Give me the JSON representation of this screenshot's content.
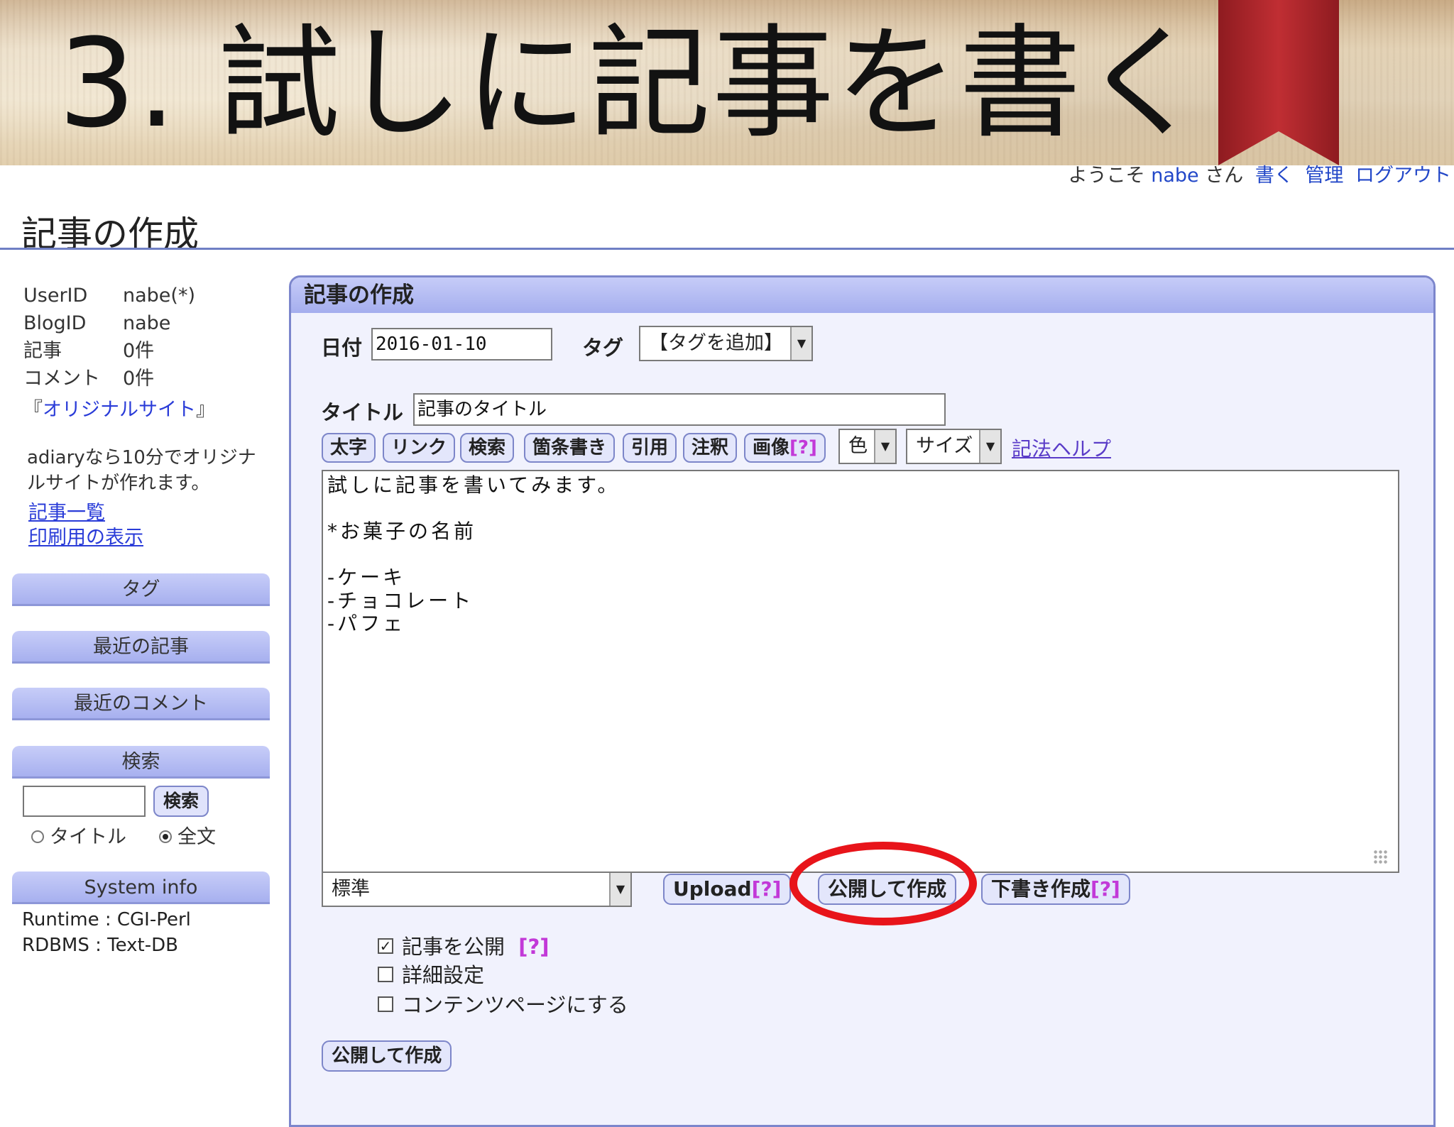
{
  "slide": {
    "title": "3. 試しに記事を書く"
  },
  "user_nav": {
    "welcome": "ようこそ",
    "user": "nabe",
    "honorific": "さん",
    "links": [
      "書く",
      "管理",
      "ログアウト"
    ]
  },
  "page": {
    "title": "記事の作成"
  },
  "sidebar": {
    "info": [
      {
        "key": "UserID",
        "value": "nabe(*)"
      },
      {
        "key": "BlogID",
        "value": "nabe"
      },
      {
        "key": "記事",
        "value": "0件"
      },
      {
        "key": "コメント",
        "value": "0件"
      }
    ],
    "original_site": {
      "open": "『",
      "link": "オリジナルサイト",
      "close": "』"
    },
    "promo": "adiaryなら10分でオリジナルサイトが作れます。",
    "links": [
      "記事一覧",
      "印刷用の表示"
    ],
    "sections": [
      "タグ",
      "最近の記事",
      "最近のコメント",
      "検索",
      "System info"
    ],
    "search": {
      "button": "検索",
      "input_value": "",
      "options": [
        {
          "label": "タイトル",
          "selected": false
        },
        {
          "label": "全文",
          "selected": true
        }
      ]
    },
    "system_info": [
      "Runtime : CGI-Perl",
      "RDBMS : Text-DB"
    ]
  },
  "editor": {
    "header": "記事の作成",
    "date_label": "日付",
    "date_value": "2016-01-10",
    "tag_label": "タグ",
    "tag_select": "【タグを追加】",
    "title_label": "タイトル",
    "title_value": "記事のタイトル",
    "toolbar": [
      "太字",
      "リンク",
      "検索",
      "箇条書き",
      "引用",
      "注釈",
      "画像"
    ],
    "help_mark": "[?]",
    "color_select": "色",
    "size_select": "サイズ",
    "syntax_help": "記法ヘルプ",
    "body": "試しに記事を書いてみます。\n\n*お菓子の名前\n\n-ケーキ\n-チョコレート\n-パフェ",
    "parser_select": "標準",
    "upload_button": "Upload",
    "publish_create_button": "公開して作成",
    "draft_create_button": "下書き作成",
    "checkboxes": [
      {
        "label": "記事を公開",
        "checked": true,
        "help": "[?]"
      },
      {
        "label": "詳細設定",
        "checked": false
      },
      {
        "label": "コンテンツページにする",
        "checked": false
      }
    ],
    "bottom_button": "公開して作成"
  },
  "colors": {
    "panel_header": "#a5aeee",
    "panel_bg": "#f1f2fd",
    "link": "#2a3cd8",
    "highlight": "#e8141a",
    "ribbon": "#b3262b"
  }
}
